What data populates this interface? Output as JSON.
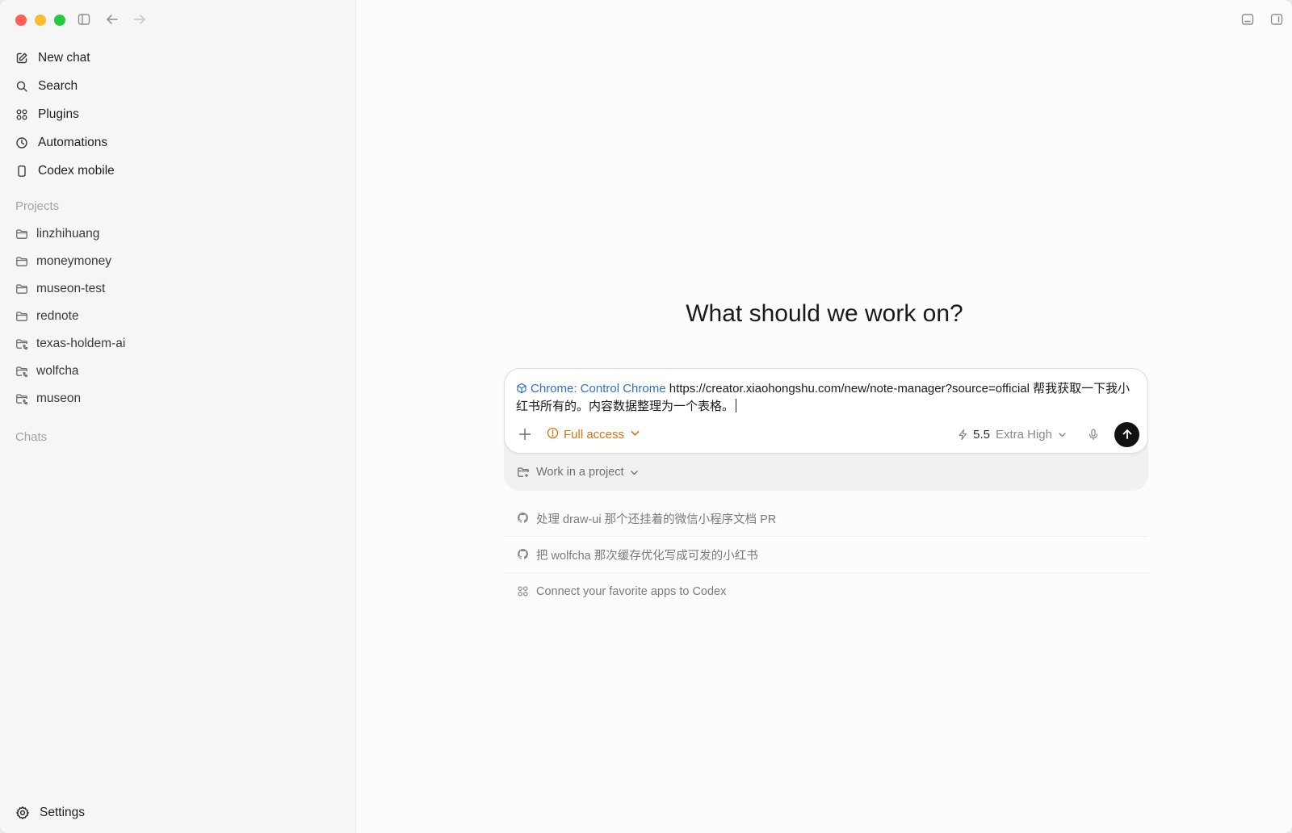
{
  "sidebar": {
    "nav": [
      {
        "label": "New chat",
        "icon": "compose-icon"
      },
      {
        "label": "Search",
        "icon": "search-icon"
      },
      {
        "label": "Plugins",
        "icon": "grid-icon"
      },
      {
        "label": "Automations",
        "icon": "clock-icon"
      },
      {
        "label": "Codex mobile",
        "icon": "phone-icon"
      }
    ],
    "projects_title": "Projects",
    "projects": [
      {
        "label": "linzhihuang",
        "icon": "folder-icon"
      },
      {
        "label": "moneymoney",
        "icon": "folder-icon"
      },
      {
        "label": "museon-test",
        "icon": "folder-icon"
      },
      {
        "label": "rednote",
        "icon": "folder-icon"
      },
      {
        "label": "texas-holdem-ai",
        "icon": "folder-git-icon"
      },
      {
        "label": "wolfcha",
        "icon": "folder-git-icon"
      },
      {
        "label": "museon",
        "icon": "folder-git-icon"
      }
    ],
    "chats_title": "Chats",
    "settings_label": "Settings"
  },
  "main": {
    "heading": "What should we work on?",
    "composer": {
      "chip_label": "Chrome: Control Chrome",
      "text": "https://creator.xiaohongshu.com/new/note-manager?source=official 帮我获取一下我小红书所有的。内容数据整理为一个表格。",
      "access_label": "Full access",
      "model_version": "5.5",
      "model_effort": "Extra High"
    },
    "project_select_label": "Work in a project",
    "suggestions": [
      {
        "label": "处理 draw-ui 那个还挂着的微信小程序文档 PR",
        "icon": "github-icon"
      },
      {
        "label": "把 wolfcha 那次缓存优化写成可发的小红书",
        "icon": "github-icon"
      },
      {
        "label": "Connect your favorite apps to Codex",
        "icon": "grid-icon"
      }
    ]
  },
  "colors": {
    "accent_blue": "#2f6fcf",
    "access_orange": "#d9730d",
    "send_button": "#111111"
  }
}
